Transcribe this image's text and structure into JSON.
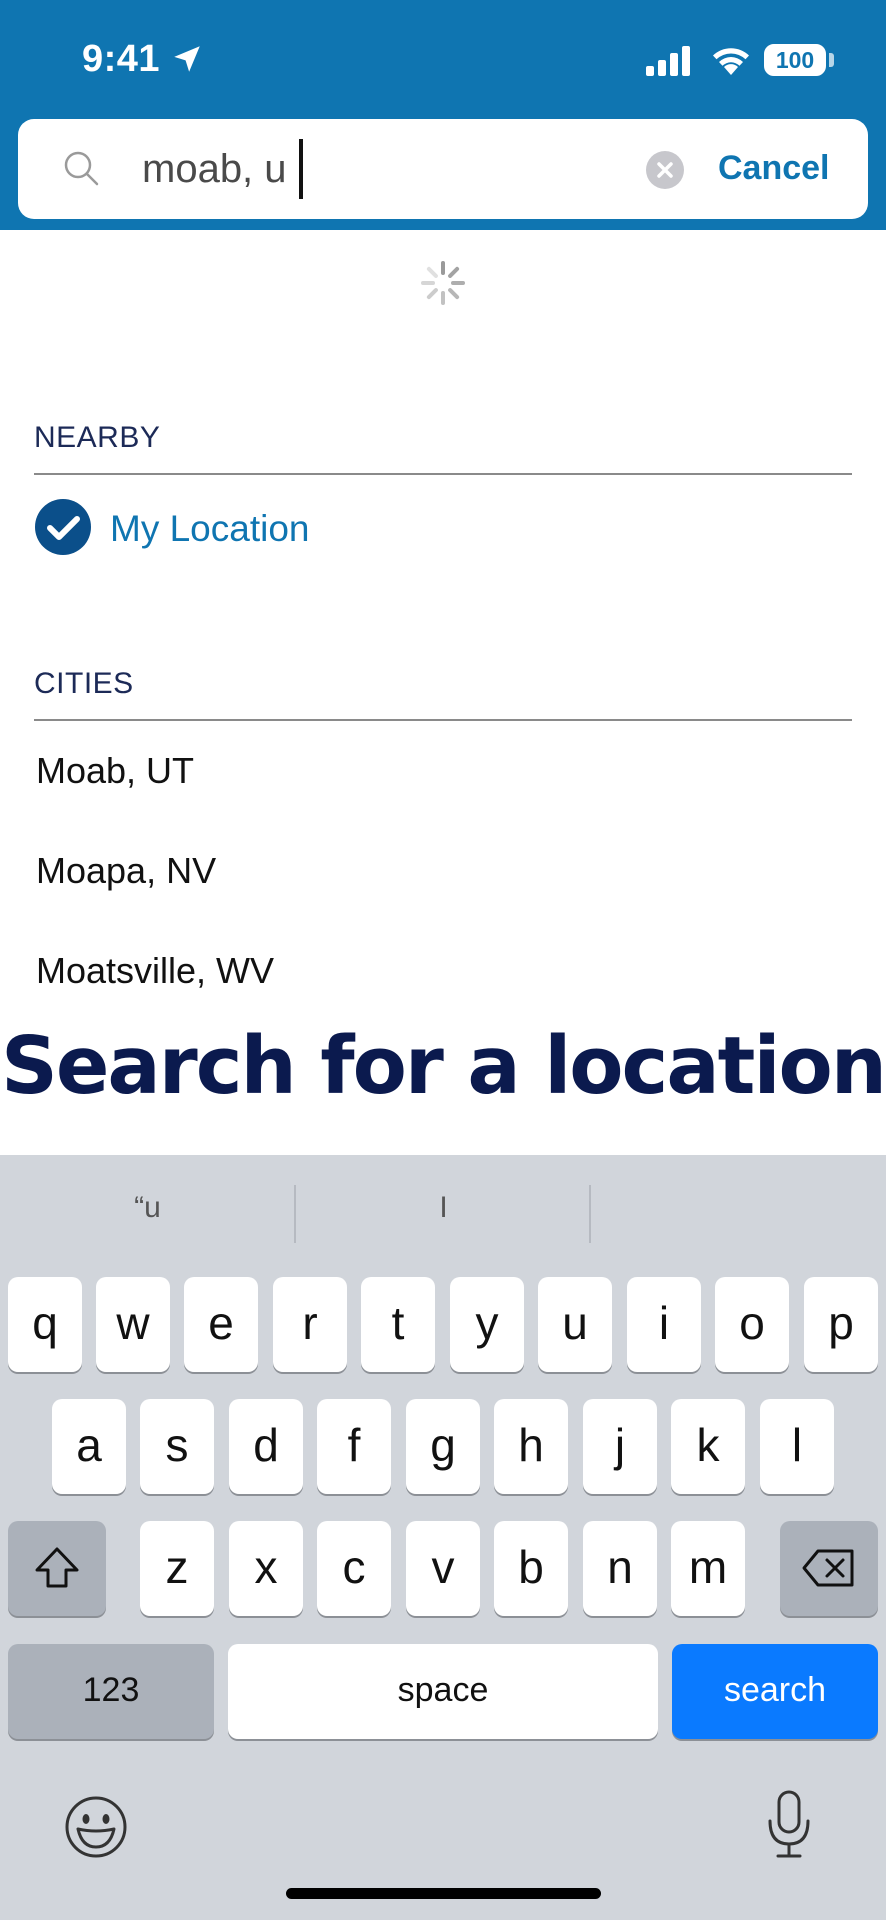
{
  "status_bar": {
    "time": "9:41",
    "battery": "100"
  },
  "search": {
    "value": "moab, u",
    "cancel_label": "Cancel"
  },
  "nearby": {
    "header": "NEARBY",
    "my_location_label": "My Location"
  },
  "cities": {
    "header": "CITIES",
    "items": [
      "Moab, UT",
      "Moapa, NV",
      "Moatsville, WV"
    ]
  },
  "promo_text": "Search for a location",
  "keyboard": {
    "suggestions": [
      "“u",
      "I",
      ""
    ],
    "row1": [
      "q",
      "w",
      "e",
      "r",
      "t",
      "y",
      "u",
      "i",
      "o",
      "p"
    ],
    "row2": [
      "a",
      "s",
      "d",
      "f",
      "g",
      "h",
      "j",
      "k",
      "l"
    ],
    "row3": [
      "z",
      "x",
      "c",
      "v",
      "b",
      "n",
      "m"
    ],
    "numbers_label": "123",
    "space_label": "space",
    "search_label": "search"
  },
  "colors": {
    "header_blue": "#0f75b1",
    "keyboard_bg": "#d1d5db",
    "search_key": "#0a7aff"
  }
}
